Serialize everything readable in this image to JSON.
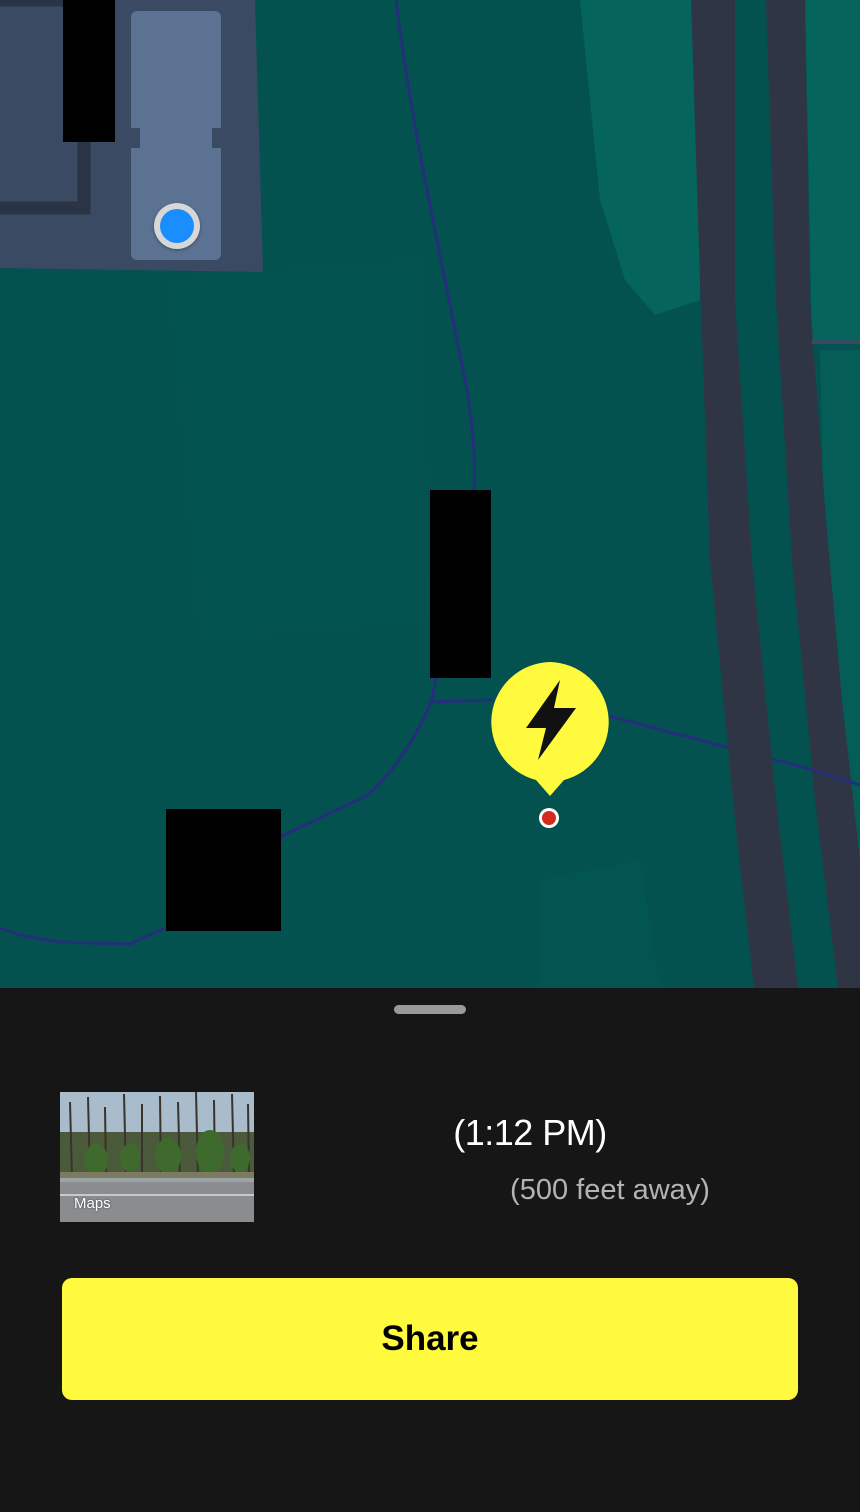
{
  "map": {
    "background_color": "#03524f",
    "road_color": "#2f3544",
    "path_color": "#242e7a",
    "pin_color": "#fffa3e",
    "pin_icon": "lightning-bolt-icon",
    "user_location_color": "#1a8dff"
  },
  "location_card": {
    "thumbnail_label": "Maps",
    "thumbnail_logo_icon": "apple-logo-icon",
    "time_text": "(1:12 PM)",
    "distance_text": "(500 feet away)"
  },
  "actions": {
    "share_label": "Share",
    "share_color": "#fffa3e"
  }
}
